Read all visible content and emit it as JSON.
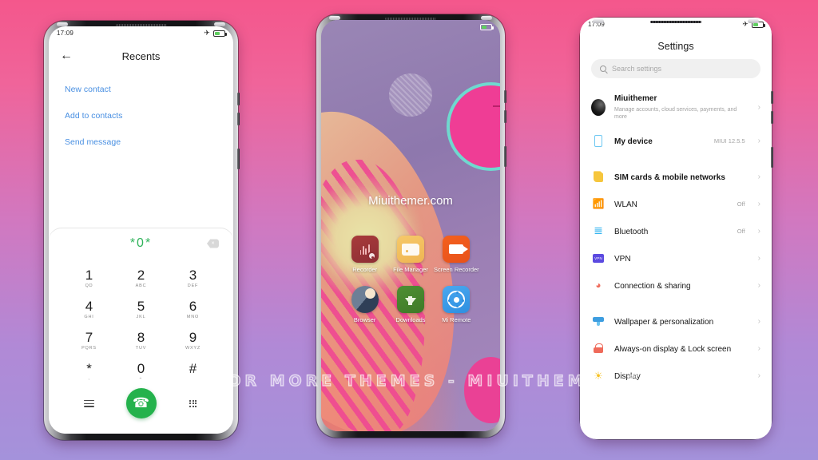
{
  "watermark": "VISIT FOR MORE THEMES - MIUITHEMER.COM",
  "status": {
    "time": "17:09",
    "airplane_icon": "airplane-mode-icon",
    "battery_icon": "battery-icon"
  },
  "phone_left": {
    "name": "dialer-phone",
    "header": {
      "back_icon": "back-arrow-icon",
      "title": "Recents"
    },
    "actions": [
      {
        "label": "New contact"
      },
      {
        "label": "Add to contacts"
      },
      {
        "label": "Send message"
      }
    ],
    "dialer": {
      "number": "*0*",
      "backspace_icon": "backspace-icon",
      "keys": [
        {
          "digit": "1",
          "letters": "QD"
        },
        {
          "digit": "2",
          "letters": "ABC"
        },
        {
          "digit": "3",
          "letters": "DEF"
        },
        {
          "digit": "4",
          "letters": "GHI"
        },
        {
          "digit": "5",
          "letters": "JKL"
        },
        {
          "digit": "6",
          "letters": "MNO"
        },
        {
          "digit": "7",
          "letters": "PQRS"
        },
        {
          "digit": "8",
          "letters": "TUV"
        },
        {
          "digit": "9",
          "letters": "WXYZ"
        },
        {
          "digit": "*",
          "letters": ","
        },
        {
          "digit": "0",
          "letters": "+"
        },
        {
          "digit": "#",
          "letters": ""
        }
      ],
      "menu_icon": "menu-icon",
      "call_icon": "call-icon",
      "keypad_icon": "keypad-icon",
      "accent_color": "#24b24c",
      "number_color": "#2fb35a"
    },
    "link_color": "#4a90e2"
  },
  "phone_mid": {
    "name": "home-screen-phone",
    "brand_text": "Miuithemer.com",
    "apps": [
      {
        "label": "Recorder",
        "icon": "recorder-icon"
      },
      {
        "label": "File Manager",
        "icon": "file-manager-icon"
      },
      {
        "label": "Screen Recorder",
        "icon": "screen-recorder-icon"
      },
      {
        "label": "Browser",
        "icon": "browser-icon"
      },
      {
        "label": "Downloads",
        "icon": "downloads-icon"
      },
      {
        "label": "Mi Remote",
        "icon": "mi-remote-icon"
      }
    ]
  },
  "phone_right": {
    "name": "settings-phone",
    "title": "Settings",
    "search": {
      "placeholder": "Search settings",
      "icon": "search-icon"
    },
    "account": {
      "name": "Miuithemer",
      "subtitle": "Manage accounts, cloud services, payments, and more",
      "avatar": "avatar"
    },
    "items": [
      {
        "label": "My device",
        "value": "MIUI 12.5.5",
        "icon": "device-icon"
      },
      {
        "label": "SIM cards & mobile networks",
        "value": "",
        "icon": "sim-icon"
      },
      {
        "label": "WLAN",
        "value": "Off",
        "icon": "wifi-icon"
      },
      {
        "label": "Bluetooth",
        "value": "Off",
        "icon": "bluetooth-icon"
      },
      {
        "label": "VPN",
        "value": "",
        "icon": "vpn-icon"
      },
      {
        "label": "Connection & sharing",
        "value": "",
        "icon": "connection-sharing-icon"
      },
      {
        "label": "Wallpaper & personalization",
        "value": "",
        "icon": "wallpaper-icon"
      },
      {
        "label": "Always-on display & Lock screen",
        "value": "",
        "icon": "lock-icon"
      },
      {
        "label": "Display",
        "value": "",
        "icon": "display-icon"
      }
    ],
    "chevron_icon": "chevron-right-icon",
    "vpn_badge": "VPN"
  },
  "background": {
    "top_color": "#f4578c",
    "bottom_color": "#a492db"
  }
}
